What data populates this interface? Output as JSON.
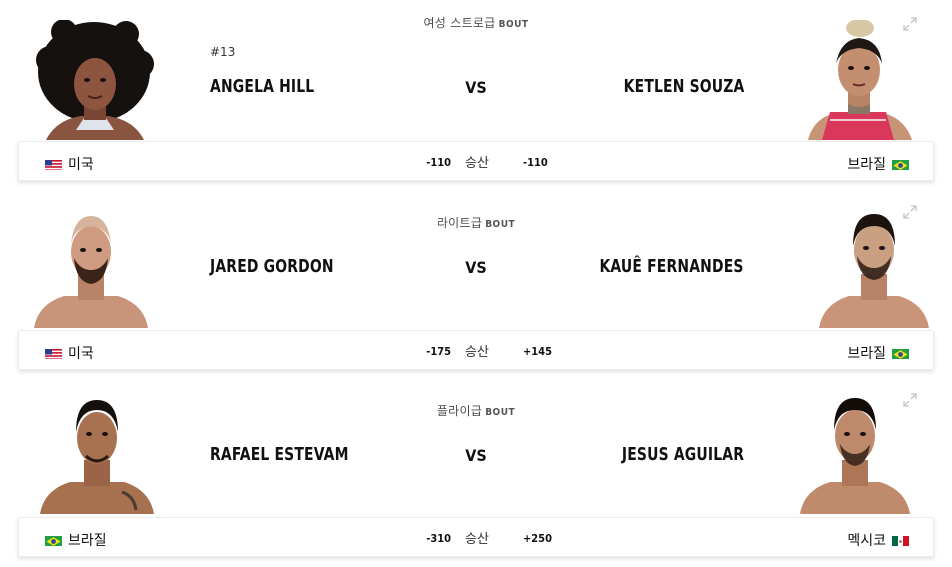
{
  "odds_label": "승산",
  "vs_label": "VS",
  "bouts": [
    {
      "weight_class": "여성 스트로급",
      "bout_word": "BOUT",
      "left": {
        "rank": "#13",
        "name": "ANGELA HILL",
        "country": "미국",
        "flag": "usa-flag-icon",
        "odds": "-110"
      },
      "right": {
        "rank": "",
        "name": "KETLEN SOUZA",
        "country": "브라질",
        "flag": "brazil-flag-icon",
        "odds": "-110"
      }
    },
    {
      "weight_class": "라이트급",
      "bout_word": "BOUT",
      "left": {
        "rank": "",
        "name": "JARED GORDON",
        "country": "미국",
        "flag": "usa-flag-icon",
        "odds": "-175"
      },
      "right": {
        "rank": "",
        "name": "KAUÊ FERNANDES",
        "country": "브라질",
        "flag": "brazil-flag-icon",
        "odds": "+145"
      }
    },
    {
      "weight_class": "플라이급",
      "bout_word": "BOUT",
      "left": {
        "rank": "",
        "name": "RAFAEL ESTEVAM",
        "country": "브라질",
        "flag": "brazil-flag-icon",
        "odds": "-310"
      },
      "right": {
        "rank": "",
        "name": "JESUS AGUILAR",
        "country": "멕시코",
        "flag": "mexico-flag-icon",
        "odds": "+250"
      }
    }
  ],
  "colors": {
    "skin": "#b07a5c",
    "skin_light": "#d4a389",
    "hair": "#1a1410",
    "pink": "#d9385a",
    "shadow": "#8a5b44"
  }
}
